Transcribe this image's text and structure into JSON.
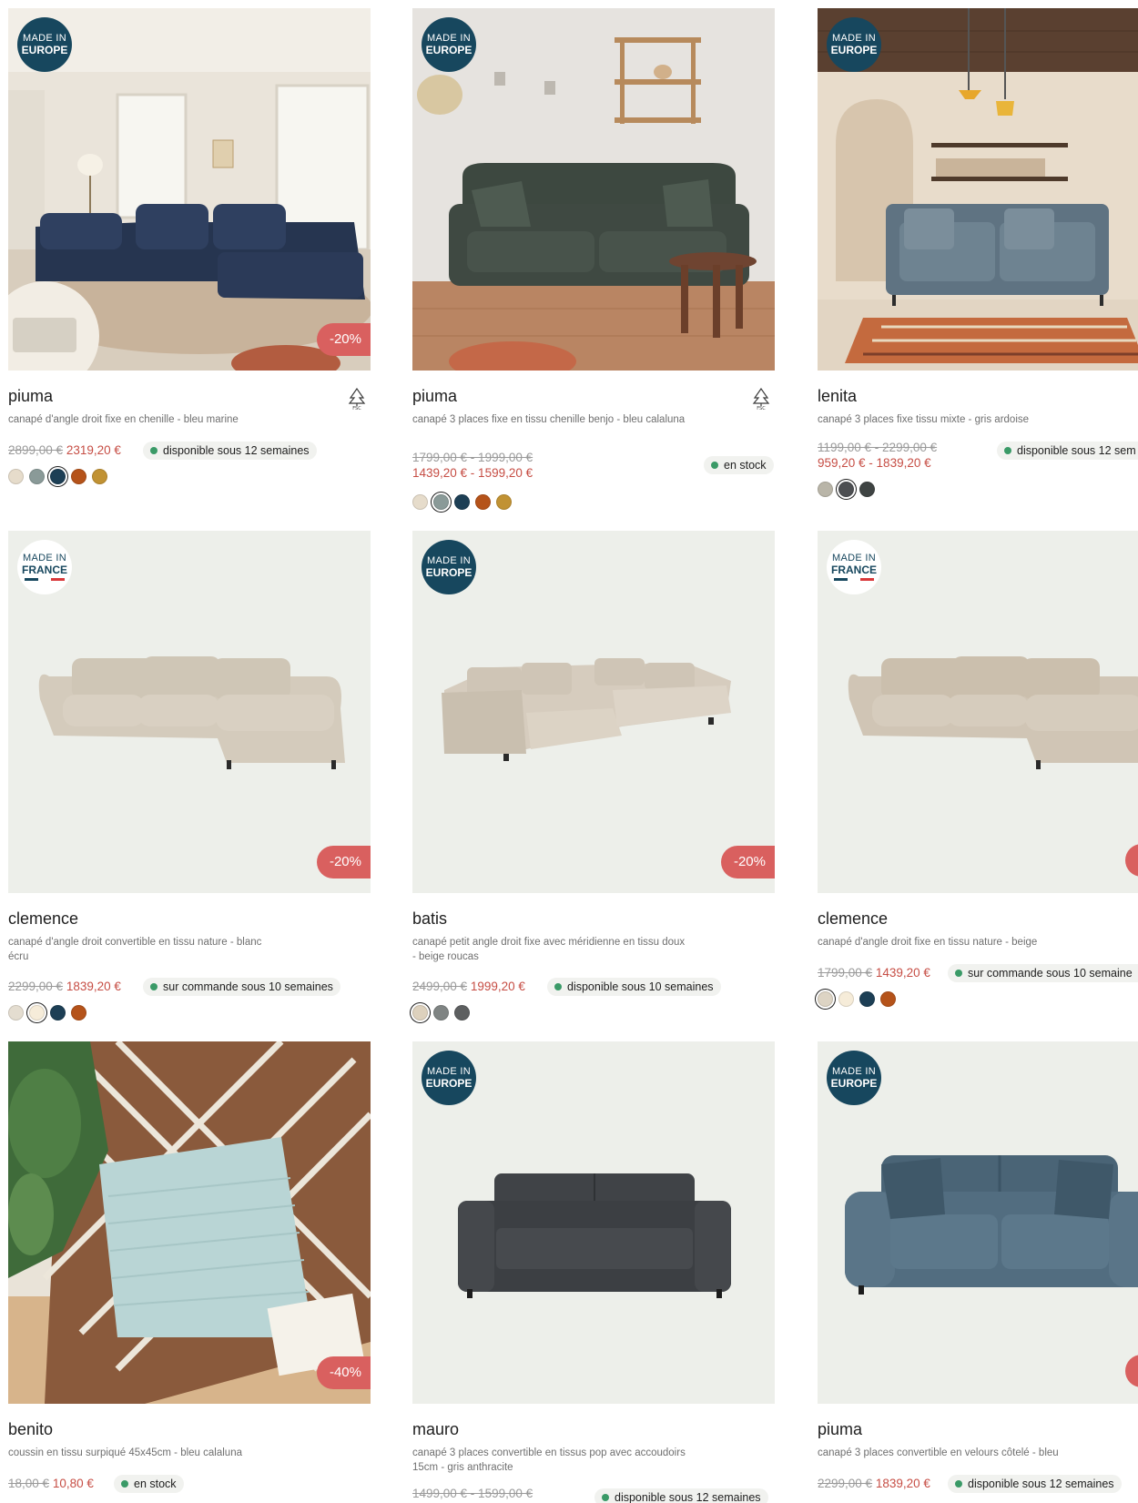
{
  "products": [
    {
      "badge": {
        "made": "MADE IN",
        "region": "EUROPE"
      },
      "discount": "-20%",
      "name": "piuma",
      "description": "canapé d'angle droit fixe en chenille - bleu marine",
      "old_price": "2899,00 €",
      "new_price": "2319,20 €",
      "stock": "disponible sous 12 semaines",
      "fsc": true,
      "swatches": [
        "#e6dccb",
        "#8a9a98",
        "#1d3f55",
        "#b5531a",
        "#c19233"
      ],
      "selected_swatch": 2
    },
    {
      "badge": {
        "made": "MADE IN",
        "region": "EUROPE"
      },
      "name": "piuma",
      "description": "canapé 3 places fixe en tissu chenille benjo - bleu calaluna",
      "old_price": "1799,00 € - 1999,00 €",
      "new_price": "1439,20 € - 1599,20 €",
      "stock": "en stock",
      "fsc": true,
      "swatches": [
        "#e6dccb",
        "#8a9a98",
        "#1d3f55",
        "#b5531a",
        "#c19233"
      ],
      "selected_swatch": 1
    },
    {
      "badge": {
        "made": "MADE IN",
        "region": "EUROPE"
      },
      "name": "lenita",
      "description": "canapé 3 places fixe tissu mixte - gris ardoise",
      "old_price": "1199,00 € - 2299,00 €",
      "new_price": "959,20 € - 1839,20 €",
      "stock": "disponible sous 12 sem",
      "swatches": [
        "#b9b5a8",
        "#4d4f52",
        "#3f4443"
      ],
      "selected_swatch": 1
    },
    {
      "badge": {
        "made": "MADE IN",
        "region": "FRANCE"
      },
      "discount": "-20%",
      "name": "clemence",
      "description": "canapé d'angle droit convertible en tissu nature - blanc écru",
      "old_price": "2299,00 €",
      "new_price": "1839,20 €",
      "stock": "sur commande sous 10 semaines",
      "swatches": [
        "#e4ddd0",
        "#f6ecd9",
        "#1d3f55",
        "#b5531a"
      ],
      "selected_swatch": 1
    },
    {
      "badge": {
        "made": "MADE IN",
        "region": "EUROPE"
      },
      "discount": "-20%",
      "name": "batis",
      "description": "canapé petit angle droit fixe avec méridienne en tissu doux - beige roucas",
      "old_price": "2499,00 €",
      "new_price": "1999,20 €",
      "stock": "disponible sous 10 semaines",
      "swatches": [
        "#ddd1bd",
        "#7f8483",
        "#5d5f60"
      ],
      "selected_swatch": 0
    },
    {
      "badge": {
        "made": "MADE IN",
        "region": "FRANCE"
      },
      "name": "clemence",
      "description": "canapé d'angle droit fixe en tissu nature - beige",
      "old_price": "1799,00 €",
      "new_price": "1439,20 €",
      "stock": "sur commande sous 10 semaine",
      "swatches": [
        "#ddd4c4",
        "#f6ecd9",
        "#1d3f55",
        "#b5531a"
      ],
      "selected_swatch": 0
    },
    {
      "discount": "-40%",
      "name": "benito",
      "description": "coussin en tissu surpiqué 45x45cm - bleu calaluna",
      "old_price": "18,00 €",
      "new_price": "10,80 €",
      "stock": "en stock"
    },
    {
      "badge": {
        "made": "MADE IN",
        "region": "EUROPE"
      },
      "name": "mauro",
      "description": "canapé 3 places convertible en tissus pop avec accoudoirs 15cm - gris anthracite",
      "old_price": "1499,00 € - 1599,00 €",
      "stock": "disponible sous 12 semaines"
    },
    {
      "badge": {
        "made": "MADE IN",
        "region": "EUROPE"
      },
      "name": "piuma",
      "description": "canapé 3 places convertible en velours côtelé - bleu",
      "old_price": "2299,00 €",
      "new_price": "1839,20 €",
      "stock": "disponible sous 12 semaines"
    }
  ]
}
